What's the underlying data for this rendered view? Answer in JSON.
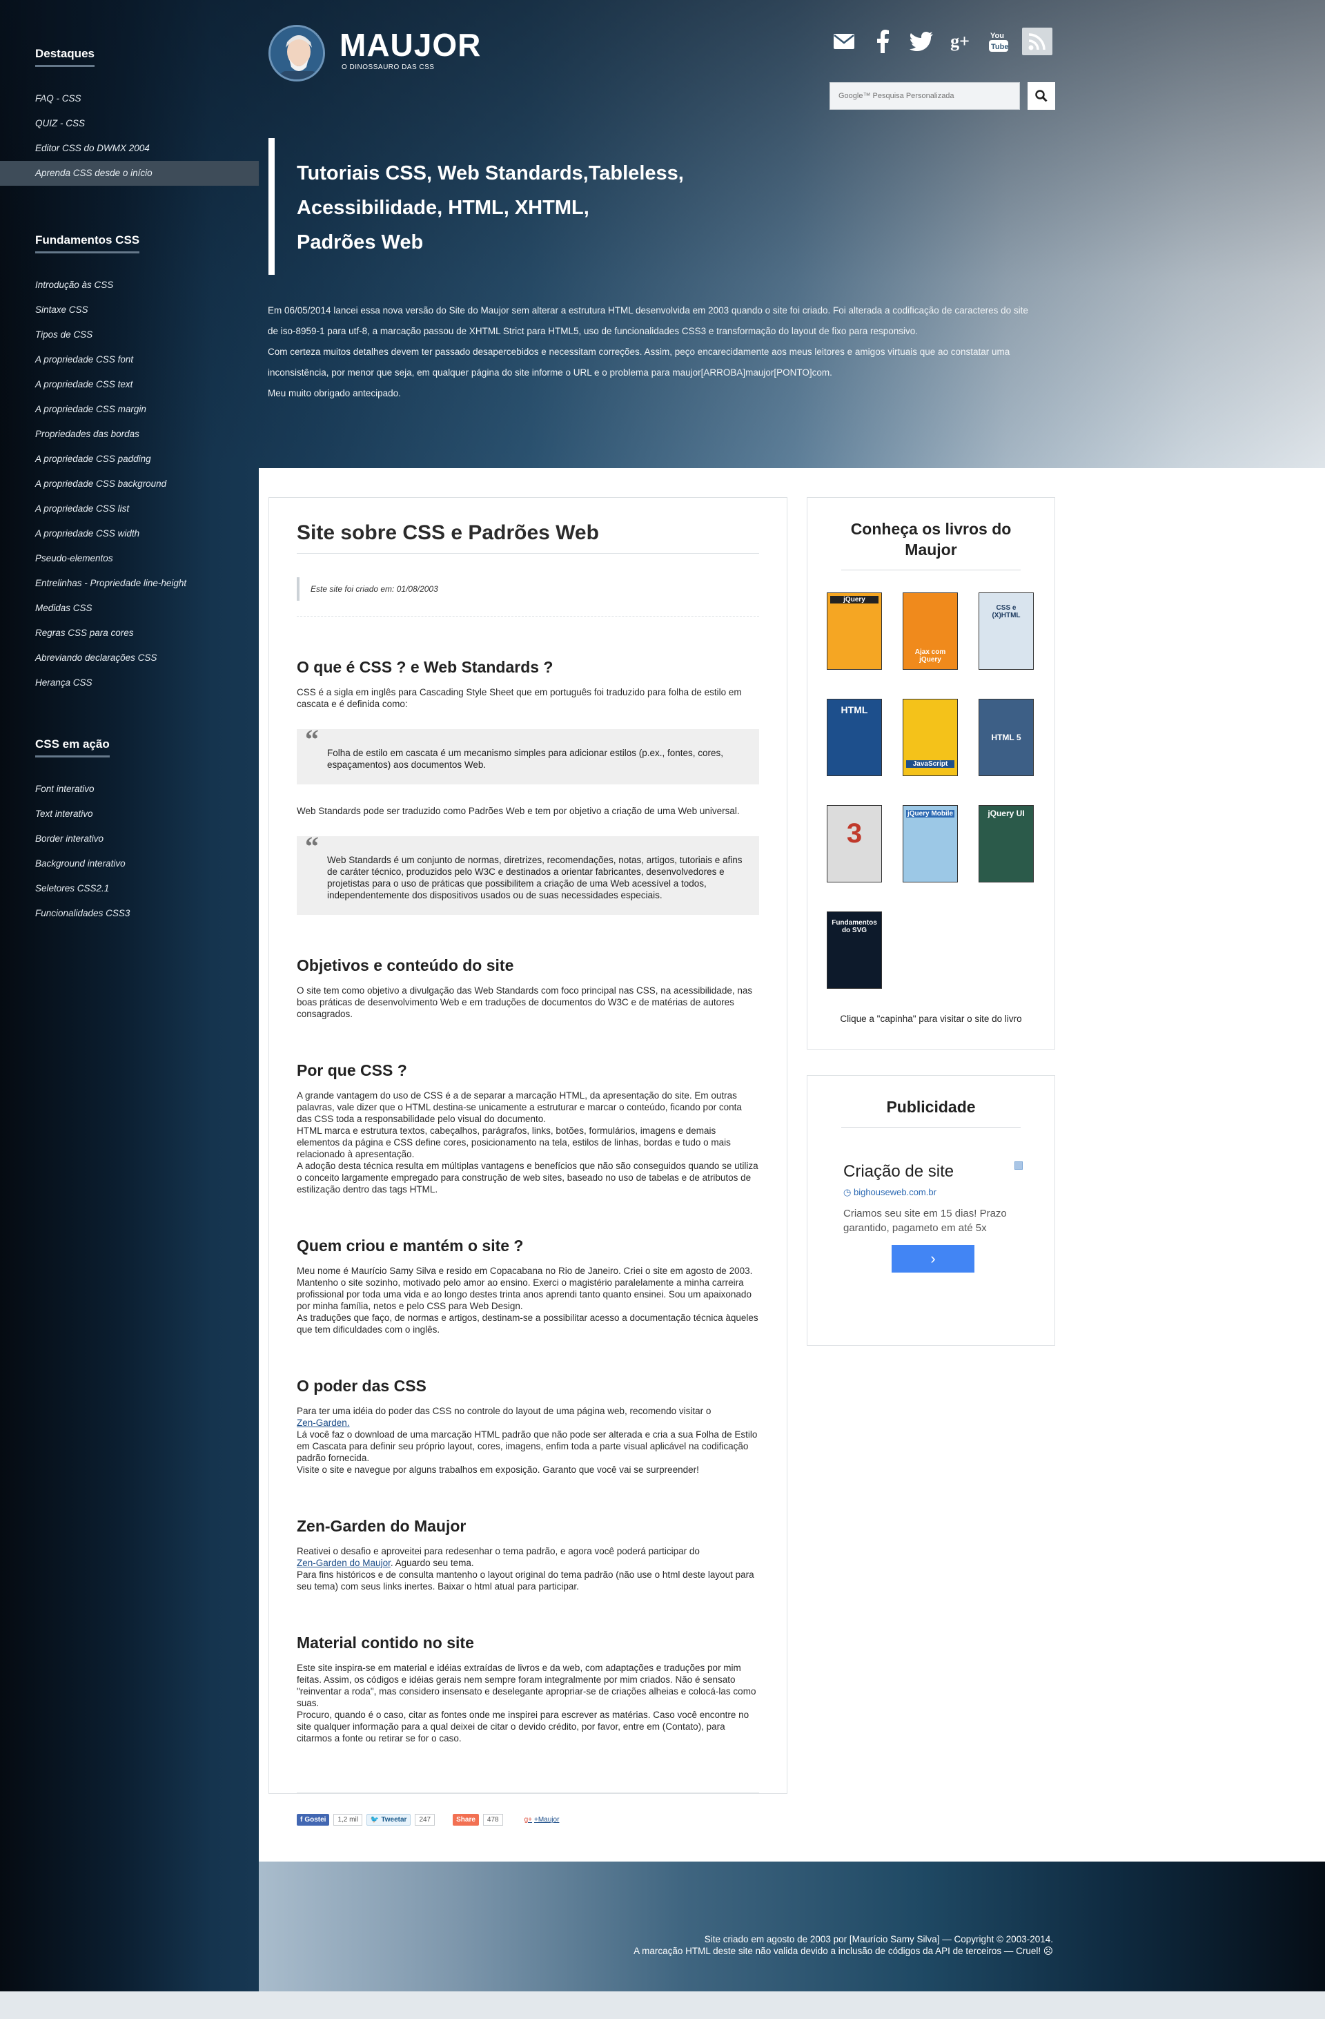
{
  "sidebar": {
    "sections": [
      {
        "title": "Destaques",
        "items": [
          {
            "label": "FAQ - CSS",
            "active": false
          },
          {
            "label": "QUIZ - CSS",
            "active": false
          },
          {
            "label": "Editor CSS do DWMX 2004",
            "active": false
          },
          {
            "label": "Aprenda CSS desde o início",
            "active": true
          }
        ]
      },
      {
        "title": "Fundamentos CSS",
        "items": [
          {
            "label": "Introdução às CSS"
          },
          {
            "label": "Sintaxe CSS"
          },
          {
            "label": "Tipos de CSS"
          },
          {
            "label": "A propriedade CSS font"
          },
          {
            "label": "A propriedade CSS text"
          },
          {
            "label": "A propriedade CSS margin"
          },
          {
            "label": "Propriedades das bordas"
          },
          {
            "label": "A propriedade CSS padding"
          },
          {
            "label": "A propriedade CSS background"
          },
          {
            "label": "A propriedade CSS list"
          },
          {
            "label": "A propriedade CSS width"
          },
          {
            "label": "Pseudo-elementos"
          },
          {
            "label": "Entrelinhas - Propriedade line-height"
          },
          {
            "label": "Medidas CSS"
          },
          {
            "label": "Regras CSS para cores"
          },
          {
            "label": "Abreviando declarações CSS"
          },
          {
            "label": "Herança CSS"
          }
        ]
      },
      {
        "title": "CSS em ação",
        "items": [
          {
            "label": "Font interativo"
          },
          {
            "label": "Text interativo"
          },
          {
            "label": "Border interativo"
          },
          {
            "label": "Background interativo"
          },
          {
            "label": "Seletores CSS2.1"
          },
          {
            "label": "Funcionalidades CSS3"
          }
        ]
      }
    ]
  },
  "header": {
    "logo_title": "MAUJOR",
    "logo_subtitle": "O DINOSSAURO DAS CSS",
    "social_icons": [
      "envelope-icon",
      "facebook-icon",
      "twitter-icon",
      "google-plus-icon",
      "youtube-icon",
      "rss-icon"
    ],
    "search_placeholder": "Google™ Pesquisa Personalizada",
    "hero_lines": [
      "Tutoriais CSS, Web Standards,Tableless,",
      "Acessibilidade, HTML, XHTML,",
      "Padrões Web"
    ],
    "intro": [
      "Em 06/05/2014 lancei essa nova versão do Site do Maujor sem alterar a estrutura HTML desenvolvida em 2003 quando o site foi criado. Foi alterada a codificação de caracteres do site de iso-8959-1 para utf-8, a marcação passou de XHTML Strict para HTML5, uso de funcionalidades CSS3 e transformação do layout de fixo para responsivo.",
      "Com certeza muitos detalhes devem ter passado desapercebidos e necessitam correções. Assim, peço encarecidamente aos meus leitores e amigos virtuais que ao  constatar uma inconsistência, por menor que seja, em qualquer página do site informe o URL e o problema para maujor[ARROBA]maujor[PONTO]com.",
      "Meu muito obrigado antecipado."
    ]
  },
  "article": {
    "title": "Site sobre CSS e Padrões Web",
    "created": "Este site foi criado em: 01/08/2003",
    "s1_title": "O que é CSS ? e Web Standards ?",
    "s1_p1": "CSS é a sigla em inglês para Cascading Style Sheet que em português foi traduzido para folha de estilo em cascata e é definida como:",
    "s1_q1": "Folha de estilo em cascata é um mecanismo simples para adicionar estilos (p.ex., fontes, cores, espaçamentos) aos documentos Web.",
    "s1_p2": "Web Standards pode ser traduzido como Padrões Web e tem por objetivo a criação de uma Web universal.",
    "s1_q2": "Web Standards é um conjunto de normas, diretrizes, recomendações, notas, artigos, tutoriais e afins de caráter técnico, produzidos pelo W3C e destinados a orientar fabricantes, desenvolvedores e projetistas para o uso de práticas que possibilitem a criação de uma Web acessível a todos, independentemente dos dispositivos usados ou de suas necessidades especiais.",
    "s2_title": "Objetivos e conteúdo do site",
    "s2_p": "O site tem como objetivo a divulgação das Web Standards com foco principal nas CSS, na acessibilidade, nas boas práticas de desenvolvimento Web e em traduções de documentos do W3C e de matérias de autores consagrados.",
    "s3_title": "Por que CSS ?",
    "s3_p1": "A grande vantagem do uso de CSS é a de separar a marcação HTML, da apresentação do site. Em outras palavras, vale dizer que o HTML destina-se unicamente a estruturar e marcar o conteúdo, ficando por conta das CSS toda a responsabilidade pelo visual do documento.",
    "s3_p2": "HTML marca e estrutura textos, cabeçalhos, parágrafos, links, botões, formulários, imagens e demais elementos da página e CSS define cores, posicionamento na tela, estilos de linhas, bordas e tudo o mais relacionado à apresentação.",
    "s3_p3": "A adoção desta técnica resulta em múltiplas vantagens e benefícios que não são conseguidos quando se utiliza o conceito largamente empregado para construção de web sites, baseado no uso de tabelas e de atributos de estilização dentro das tags HTML.",
    "s4_title": "Quem criou e mantém o site ?",
    "s4_p1": "Meu nome é Maurício Samy Silva e resido em Copacabana no Rio de Janeiro. Criei o site em agosto de 2003. Mantenho o site sozinho, motivado pelo amor ao ensino. Exerci o magistério paralelamente a minha carreira profissional por toda uma vida e ao longo destes trinta anos aprendi tanto quanto ensinei. Sou  um apaixonado por minha família, netos e pelo CSS para Web Design.",
    "s4_p2": "As traduções que faço, de normas e artigos, destinam-se a possibilitar acesso a documentação técnica àqueles que tem dificuldades com o inglês.",
    "s5_title": "O poder das CSS",
    "s5_p1": "Para ter uma idéia do poder das CSS no controle do layout de uma página web, recomendo visitar o",
    "s5_link": "Zen-Garden.",
    "s5_p2": "Lá você faz o download de uma marcação HTML padrão que não pode ser alterada e cria a sua Folha de Estilo em Cascata para definir seu próprio layout, cores, imagens, enfim toda a parte visual aplicável na codificação padrão fornecida.",
    "s5_p3": "Visite o site e navegue por alguns trabalhos em exposição. Garanto que você vai se surpreender!",
    "s6_title": "Zen-Garden do Maujor",
    "s6_p1a": "Reativei o desafio e aproveitei para redesenhar o tema padrão, e agora você poderá participar do",
    "s6_link": "Zen-Garden do Maujor",
    "s6_p1b": ". Aguardo seu tema.",
    "s6_p2": "Para fins históricos e de consulta mantenho o layout original do tema padrão (não use o html deste layout para seu tema) com seus links inertes. Baixar o html atual para participar.",
    "s7_title": "Material contido no site",
    "s7_p1": "Este site inspira-se em material e idéias extraídas de livros e da web, com adaptações e traduções por mim feitas. Assim, os códigos e idéias gerais nem sempre foram integralmente por mim criados. Não é sensato  \"reinventar a roda\", mas considero insensato e deselegante apropriar-se de criações alheias e colocá-las como suas.",
    "s7_p2": "Procuro, quando é o caso, citar as fontes onde me inspirei para escrever as matérias. Caso você encontre no site qualquer informação para a qual deixei de citar o devido crédito, por favor, entre em (Contato), para citarmos a fonte ou retirar se for o caso.",
    "share": {
      "like_label": "Gostei",
      "like_count": "1,2 mil",
      "tweet_label": "Tweetar",
      "tweet_count": "247",
      "share_label": "Share",
      "share_count": "478",
      "gplus_label": "+Maujor"
    }
  },
  "books_box": {
    "title": "Conheça os livros do Maujor",
    "books": [
      {
        "label": "jQuery",
        "color": "#f5a623"
      },
      {
        "label": "Ajax com jQuery",
        "color": "#f08a1c"
      },
      {
        "label": "CSS e (X)HTML",
        "color": "#d9e4ee"
      },
      {
        "label": "HTML",
        "color": "#1d4f8c"
      },
      {
        "label": "JavaScript",
        "color": "#f4c21a"
      },
      {
        "label": "HTML 5",
        "color": "#3d5f86"
      },
      {
        "label": "3",
        "color": "#dcdcdc"
      },
      {
        "label": "jQuery Mobile",
        "color": "#9cc8e6"
      },
      {
        "label": "jQuery UI",
        "color": "#2b5a4a"
      },
      {
        "label": "Fundamentos do SVG",
        "color": "#0d1a2b"
      }
    ],
    "caption": "Clique a \"capinha\" para visitar o site do livro"
  },
  "ad_box": {
    "title": "Publicidade",
    "ad_title": "Criação de site",
    "ad_link": "bighouseweb.com.br",
    "ad_text": "Criamos seu site em 15 dias! Prazo garantido, pagameto em até 5x",
    "ad_button": "›"
  },
  "footer": {
    "line1": "Site criado em agosto de 2003 por [Maurício Samy Silva] — Copyright © 2003-2014.",
    "line2": "A marcação HTML deste site não valida devido a inclusão de códigos da API de terceiros — Cruel! ☹"
  }
}
